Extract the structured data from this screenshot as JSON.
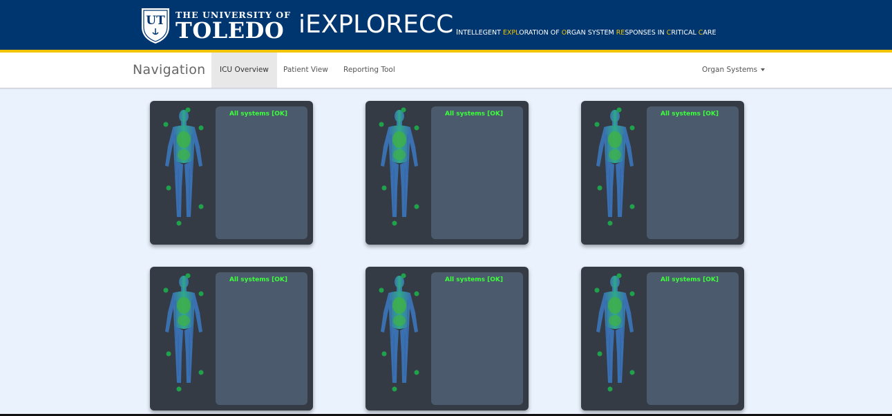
{
  "header": {
    "logo": {
      "monogram": "UT",
      "line1": "THE UNIVERSITY OF",
      "line2": "TOLEDO"
    },
    "app_title": "iEXPLORECC",
    "subtitle_parts": [
      {
        "text": "I",
        "style": "big"
      },
      {
        "text": "NTELLEGENT ",
        "style": "normal"
      },
      {
        "text": "EXPL",
        "style": "yellow"
      },
      {
        "text": "ORATION OF ",
        "style": "normal"
      },
      {
        "text": "O",
        "style": "yellow"
      },
      {
        "text": "RGAN SYSTEM ",
        "style": "normal"
      },
      {
        "text": "RE",
        "style": "yellow"
      },
      {
        "text": "SPONSES IN ",
        "style": "normal"
      },
      {
        "text": "C",
        "style": "yellow"
      },
      {
        "text": "RITICAL ",
        "style": "normal"
      },
      {
        "text": "C",
        "style": "yellow"
      },
      {
        "text": "ARE",
        "style": "normal"
      }
    ]
  },
  "nav": {
    "brand": "Navigation",
    "tabs": [
      {
        "label": "ICU Overview",
        "active": true
      },
      {
        "label": "Patient View",
        "active": false
      },
      {
        "label": "Reporting Tool",
        "active": false
      }
    ],
    "dropdown_label": "Organ Systems"
  },
  "patients": [
    {
      "status": "All systems [OK]"
    },
    {
      "status": "All systems [OK]"
    },
    {
      "status": "All systems [OK]"
    },
    {
      "status": "All systems [OK]"
    },
    {
      "status": "All systems [OK]"
    },
    {
      "status": "All systems [OK]"
    }
  ],
  "colors": {
    "header_bg": "#003670",
    "accent_yellow": "#f2c500",
    "card_bg": "#353b45",
    "panel_bg": "#4b5a6c",
    "status_ok": "#3cff3c",
    "page_bg": "#eaf2fd"
  },
  "icons": {
    "logo": "ut-shield-icon",
    "body": "human-body-anatomy-icon",
    "organ_marker": "virus-icon",
    "dropdown": "caret-down-icon"
  }
}
